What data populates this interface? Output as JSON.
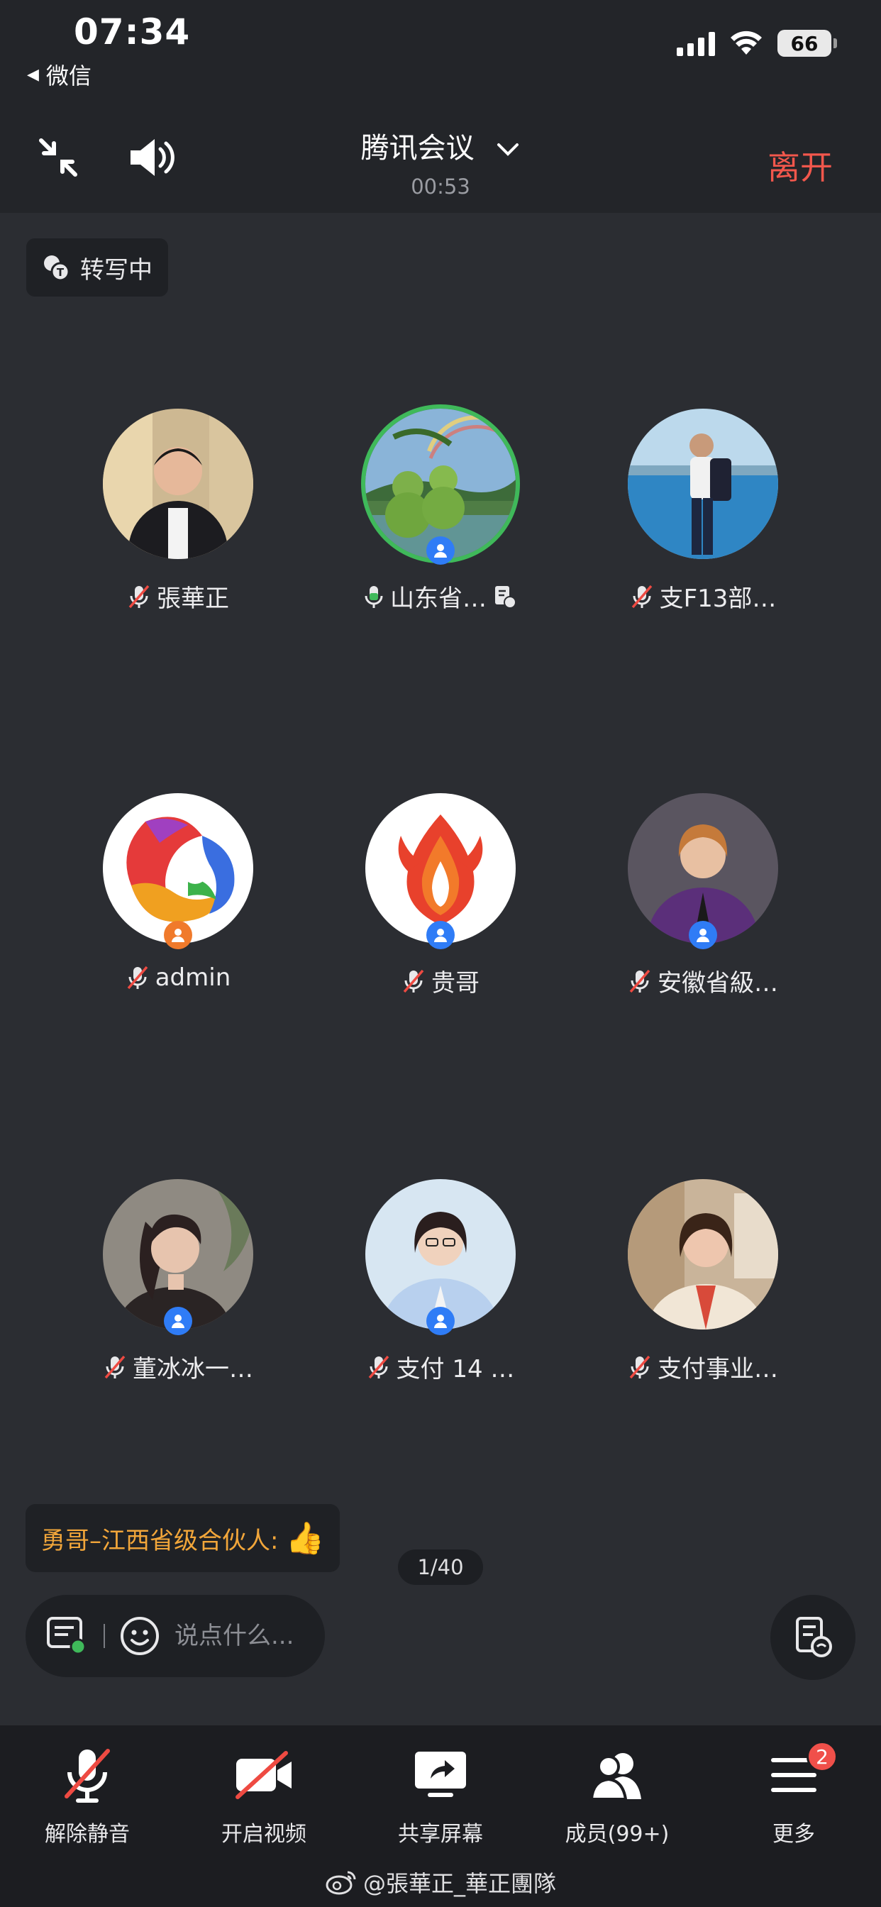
{
  "status_bar": {
    "time": "07:34",
    "back_app": "微信",
    "battery": "66"
  },
  "header": {
    "title": "腾讯会议",
    "timer": "00:53",
    "leave_label": "离开"
  },
  "transcribe": {
    "label": "转写中"
  },
  "participants": [
    {
      "name": "張華正",
      "mic": "muted",
      "badge": "none",
      "speaking": false
    },
    {
      "name": "山东省…",
      "mic": "on",
      "badge": "member",
      "speaking": true
    },
    {
      "name": "支F13部…",
      "mic": "muted",
      "badge": "none",
      "speaking": false
    },
    {
      "name": "admin",
      "mic": "muted",
      "badge": "host",
      "speaking": false
    },
    {
      "name": "贵哥",
      "mic": "muted",
      "badge": "member",
      "speaking": false
    },
    {
      "name": "安徽省級…",
      "mic": "muted",
      "badge": "member",
      "speaking": false
    },
    {
      "name": "董冰冰一…",
      "mic": "muted",
      "badge": "member",
      "speaking": false
    },
    {
      "name": "支付 14 …",
      "mic": "muted",
      "badge": "member",
      "speaking": false
    },
    {
      "name": "支付事业…",
      "mic": "muted",
      "badge": "none",
      "speaking": false
    }
  ],
  "chat": {
    "latest_message": "勇哥–江西省级合伙人:",
    "latest_emoji": "👍",
    "page_indicator": "1/40",
    "input_placeholder": "说点什么..."
  },
  "toolbar": {
    "unmute": "解除静音",
    "video": "开启视频",
    "share": "共享屏幕",
    "members": "成员(99+)",
    "more": "更多",
    "more_badge": "2"
  },
  "watermark": "@張華正_華正團隊",
  "colors": {
    "background": "#2b2d32",
    "leave": "#f2574c",
    "speaking_ring": "#3fb95a",
    "chat_name": "#f2a63a",
    "badge_blue": "#2f7cf6",
    "badge_orange": "#f07a2b"
  }
}
